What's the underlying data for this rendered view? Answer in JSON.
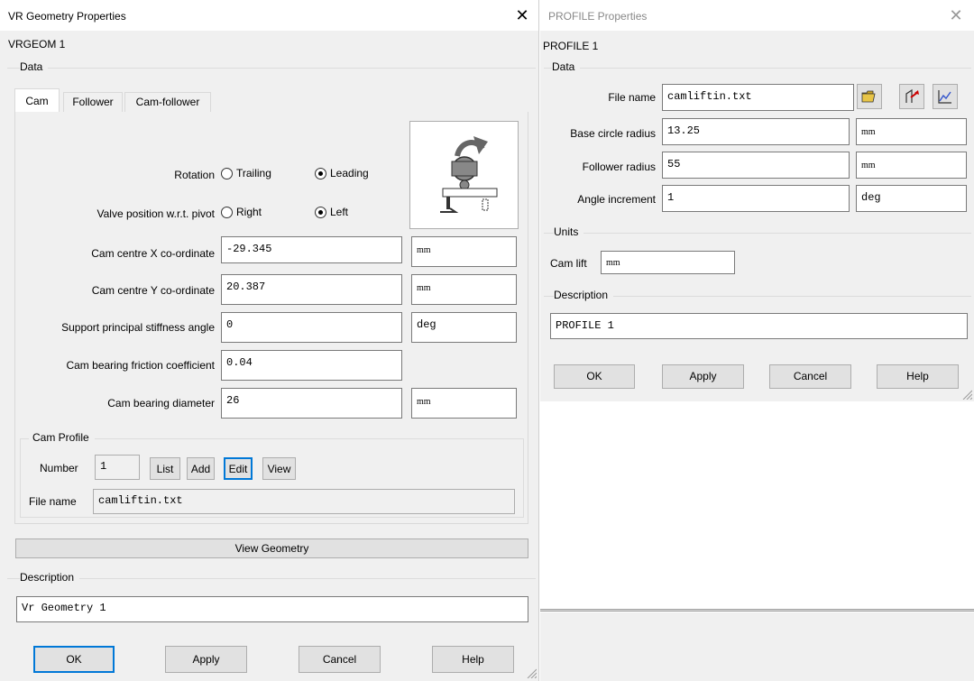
{
  "vr_dialog": {
    "title": "VR Geometry Properties",
    "close_glyph": "✕",
    "object_name": "VRGEOM 1",
    "data_group": "Data",
    "tabs": [
      "Cam",
      "Follower",
      "Cam-follower"
    ],
    "active_tab": "Cam",
    "rotation": {
      "label": "Rotation",
      "options": [
        "Trailing",
        "Leading"
      ],
      "selected": "Leading"
    },
    "valve_position": {
      "label": "Valve position w.r.t. pivot",
      "options": [
        "Right",
        "Left"
      ],
      "selected": "Left"
    },
    "fields": {
      "cam_centre_x": {
        "label": "Cam centre X co-ordinate",
        "value": "-29.345",
        "unit": "mm"
      },
      "cam_centre_y": {
        "label": "Cam centre Y co-ordinate",
        "value": "20.387",
        "unit": "mm"
      },
      "support_angle": {
        "label": "Support principal stiffness angle",
        "value": "0",
        "unit": "deg"
      },
      "friction": {
        "label": "Cam bearing friction coefficient",
        "value": "0.04"
      },
      "bearing_diameter": {
        "label": "Cam bearing diameter",
        "value": "26",
        "unit": "mm"
      }
    },
    "cam_profile": {
      "group": "Cam Profile",
      "number_label": "Number",
      "number_value": "1",
      "buttons": {
        "list": "List",
        "add": "Add",
        "edit": "Edit",
        "view": "View"
      },
      "file_label": "File name",
      "file_value": "camliftin.txt"
    },
    "view_geometry": "View Geometry",
    "description_group": "Description",
    "description_value": "Vr Geometry 1",
    "buttons": {
      "ok": "OK",
      "apply": "Apply",
      "cancel": "Cancel",
      "help": "Help"
    }
  },
  "profile_dialog": {
    "title": "PROFILE Properties",
    "close_glyph": "✕",
    "object_name": "PROFILE 1",
    "data_group": "Data",
    "fields": {
      "file_name": {
        "label": "File name",
        "value": "camliftin.txt"
      },
      "base_circle": {
        "label": "Base circle radius",
        "value": "13.25",
        "unit": "mm"
      },
      "follower_radius": {
        "label": "Follower radius",
        "value": "55",
        "unit": "mm"
      },
      "angle_increment": {
        "label": "Angle increment",
        "value": "1",
        "unit": "deg"
      }
    },
    "file_icons": [
      "open-folder-icon",
      "import-icon",
      "graph-icon"
    ],
    "units_group": "Units",
    "cam_lift_label": "Cam lift",
    "cam_lift_unit": "mm",
    "description_group": "Description",
    "description_value": "PROFILE 1",
    "buttons": {
      "ok": "OK",
      "apply": "Apply",
      "cancel": "Cancel",
      "help": "Help"
    }
  },
  "colors": {
    "panel": "#f0f0f0",
    "focus_border": "#0078d7",
    "button_face": "#e1e1e1"
  }
}
